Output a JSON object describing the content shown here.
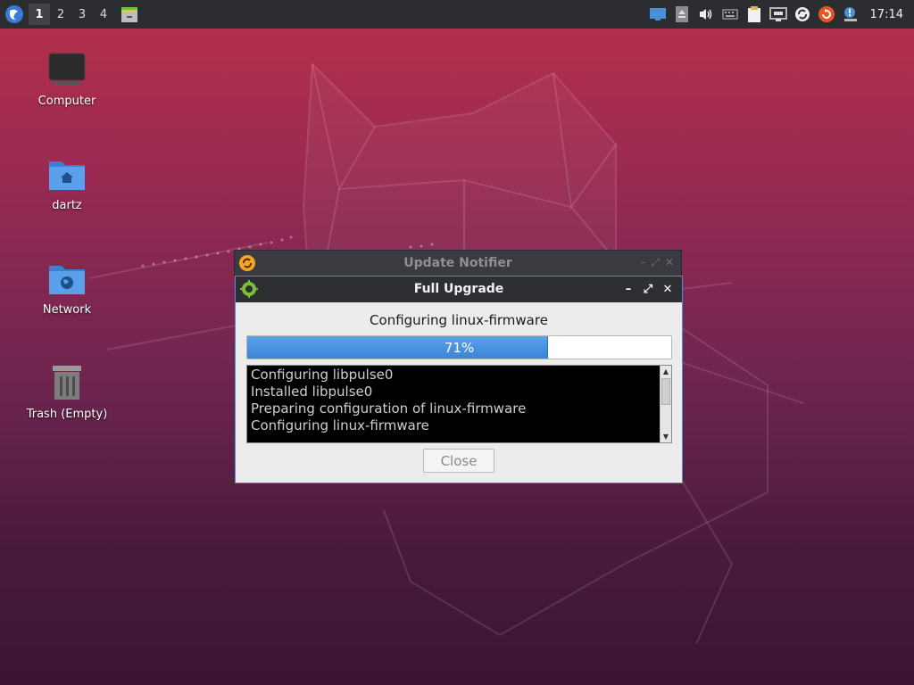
{
  "panel": {
    "workspaces": [
      "1",
      "2",
      "3",
      "4"
    ],
    "active_workspace": "1",
    "clock": "17:14"
  },
  "desktop": {
    "icons": [
      {
        "label": "Computer",
        "icon": "computer-icon"
      },
      {
        "label": "dartz",
        "icon": "home-folder-icon"
      },
      {
        "label": "Network",
        "icon": "network-folder-icon"
      },
      {
        "label": "Trash (Empty)",
        "icon": "trash-icon"
      }
    ]
  },
  "bg_window": {
    "title": "Update Notifier"
  },
  "dialog": {
    "title": "Full Upgrade",
    "status": "Configuring linux-firmware",
    "progress": 71,
    "progress_label": "71%",
    "log": [
      "Configuring libpulse0",
      "Installed libpulse0",
      "Preparing configuration of linux-firmware",
      "Configuring linux-firmware"
    ],
    "close_label": "Close"
  },
  "colors": {
    "accent": "#4a90d9",
    "progress": "#3b84d8",
    "panel": "#2c2d31"
  }
}
